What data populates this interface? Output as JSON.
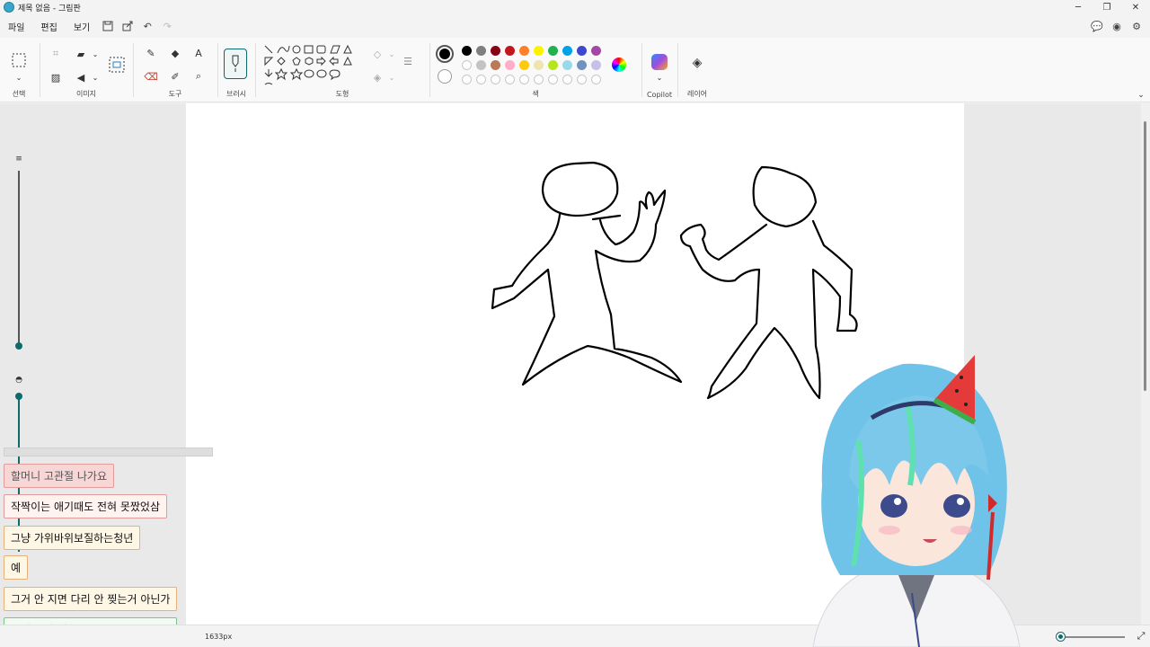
{
  "window": {
    "title": "제목 없음 - 그림판",
    "controls": {
      "minimize": "─",
      "maximize": "❐",
      "close": "✕"
    }
  },
  "menu": {
    "file": "파일",
    "edit": "편집",
    "view": "보기"
  },
  "ribbon": {
    "select_label": "선택",
    "image_label": "이미지",
    "tools_label": "도구",
    "brush_label": "브러시",
    "shapes_label": "도형",
    "colors_label": "색",
    "copilot_label": "Copilot",
    "layers_label": "레이어"
  },
  "palette": {
    "primary": "#000000",
    "row1": [
      "#000000",
      "#7f7f7f",
      "#880015",
      "#c3161c",
      "#ff7f27",
      "#fff200",
      "#22b14c",
      "#00a2e8",
      "#3f48cc",
      "#a349a4"
    ],
    "row2": [
      "#ffffff",
      "#c3c3c3",
      "#b97a57",
      "#ffaec9",
      "#ffc90e",
      "#efe4b0",
      "#b5e61d",
      "#99d9ea",
      "#7092be",
      "#c8bfe7"
    ],
    "row3_empty": 10
  },
  "status": {
    "canvas_size": "1633px"
  },
  "chat": {
    "messages": [
      "할머니 고관절 나가요",
      "작짝이는 애기때도 전혀 못짰었삼",
      "그냥 가위바위보질하는청년",
      "예",
      "그거 안 지면 다리 안 찢는거 아닌가",
      "이건 그냥 가위바위보 ㅋㅋㅋㅋㅋㅋ"
    ]
  }
}
